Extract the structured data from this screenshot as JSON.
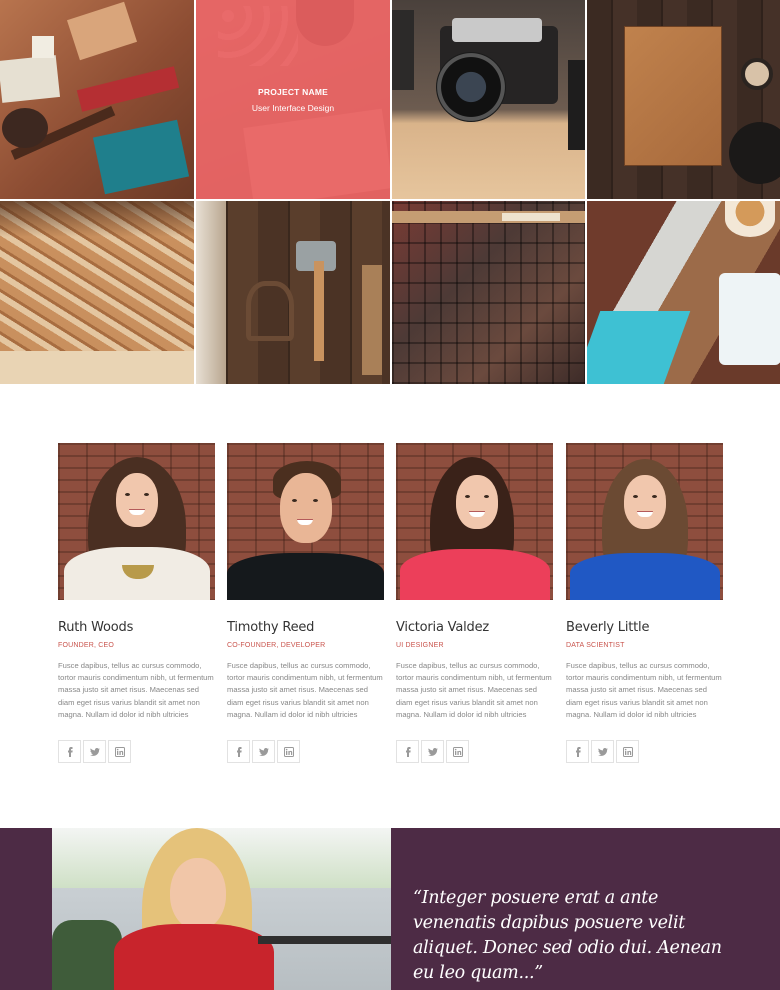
{
  "portfolio": {
    "project_name": "PROJECT NAME",
    "project_category": "User Interface Design",
    "overlay_color": "#e85454",
    "tiles": [
      {
        "label": "school-items-flatlay",
        "color": "#a7593f"
      },
      {
        "label": "notebook-keyboard",
        "color": "#d96b66"
      },
      {
        "label": "vintage-camera",
        "color": "#5b4a42"
      },
      {
        "label": "leather-notebook-table",
        "color": "#3d2b22"
      },
      {
        "label": "wooden-pencils",
        "color": "#c08d5c"
      },
      {
        "label": "old-tools-wall",
        "color": "#5a3f2d"
      },
      {
        "label": "letterpress-type",
        "color": "#5c4035"
      },
      {
        "label": "coffee-wood-boards",
        "color": "#7b4832"
      }
    ]
  },
  "team": {
    "members": [
      {
        "name": "Ruth Woods",
        "role": "FOUNDER, CEO",
        "bio": "Fusce dapibus, tellus ac cursus commodo, tortor mauris condimentum nibh, ut fermentum massa justo sit amet risus. Maecenas sed diam eget risus varius blandit sit amet non magna. Nullam id dolor id nibh ultricies vehicula ut id elit."
      },
      {
        "name": "Timothy Reed",
        "role": "CO-FOUNDER, DEVELOPER",
        "bio": "Fusce dapibus, tellus ac cursus commodo, tortor mauris condimentum nibh, ut fermentum massa justo sit amet risus. Maecenas sed diam eget risus varius blandit sit amet non magna. Nullam id dolor id nibh ultricies vehicula ut id elit."
      },
      {
        "name": "Victoria Valdez",
        "role": "UI DESIGNER",
        "bio": "Fusce dapibus, tellus ac cursus commodo, tortor mauris condimentum nibh, ut fermentum massa justo sit amet risus. Maecenas sed diam eget risus varius blandit sit amet non magna. Nullam id dolor id nibh ultricies vehicula ut id elit."
      },
      {
        "name": "Beverly Little",
        "role": "DATA SCIENTIST",
        "bio": "Fusce dapibus, tellus ac cursus commodo, tortor mauris condimentum nibh, ut fermentum massa justo sit amet risus. Maecenas sed diam eget risus varius blandit sit amet non magna. Nullam id dolor id nibh ultricies vehicula ut id elit."
      }
    ],
    "social_icons": [
      "facebook-icon",
      "twitter-icon",
      "linkedin-icon"
    ],
    "role_color": "#c9544d"
  },
  "testimonial": {
    "quote": "“Integer posuere erat a ante venenatis dapibus posuere velit aliquet. Donec sed odio dui. Aenean eu leo quam...”",
    "background_color": "#4d2b45"
  }
}
